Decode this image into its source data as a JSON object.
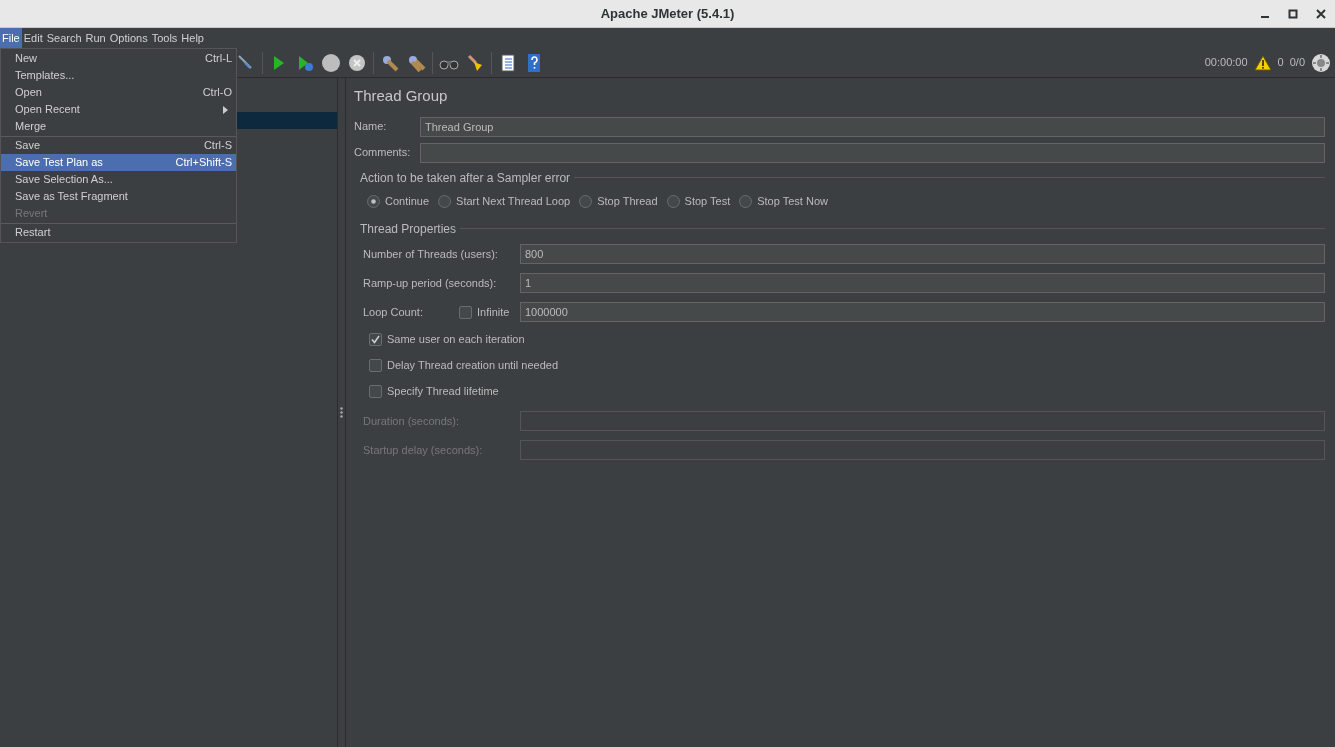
{
  "window": {
    "title": "Apache JMeter (5.4.1)"
  },
  "menu_bar": [
    {
      "label": "File",
      "selected": true
    },
    {
      "label": "Edit",
      "selected": false
    },
    {
      "label": "Search",
      "selected": false
    },
    {
      "label": "Run",
      "selected": false
    },
    {
      "label": "Options",
      "selected": false
    },
    {
      "label": "Tools",
      "selected": false
    },
    {
      "label": "Help",
      "selected": false
    }
  ],
  "file_menu": [
    {
      "label": "New",
      "shortcut": "Ctrl-L",
      "selected": false,
      "disabled": false,
      "submenu": false,
      "separator_after": false
    },
    {
      "label": "Templates...",
      "selected": false,
      "disabled": false,
      "submenu": false,
      "separator_after": false
    },
    {
      "label": "Open",
      "shortcut": "Ctrl-O",
      "selected": false,
      "disabled": false,
      "submenu": false,
      "separator_after": false
    },
    {
      "label": "Open Recent",
      "selected": false,
      "disabled": false,
      "submenu": true,
      "separator_after": false
    },
    {
      "label": "Merge",
      "selected": false,
      "disabled": false,
      "submenu": false,
      "separator_after": true
    },
    {
      "label": "Save",
      "shortcut": "Ctrl-S",
      "selected": false,
      "disabled": false,
      "submenu": false,
      "separator_after": false
    },
    {
      "label": "Save Test Plan as",
      "shortcut": "Ctrl+Shift-S",
      "selected": true,
      "disabled": false,
      "submenu": false,
      "separator_after": false
    },
    {
      "label": "Save Selection As...",
      "selected": false,
      "disabled": false,
      "submenu": false,
      "separator_after": false
    },
    {
      "label": "Save as Test Fragment",
      "selected": false,
      "disabled": false,
      "submenu": false,
      "separator_after": false
    },
    {
      "label": "Revert",
      "selected": false,
      "disabled": true,
      "submenu": false,
      "separator_after": true
    },
    {
      "label": "Restart",
      "selected": false,
      "disabled": false,
      "submenu": false,
      "separator_after": false
    }
  ],
  "toolbar_status": {
    "elapsed": "00:00:00",
    "warnings": "0",
    "threads": "0/0"
  },
  "panel": {
    "title": "Thread Group",
    "name_label": "Name:",
    "name_value": "Thread Group",
    "comments_label": "Comments:",
    "error_action": {
      "legend": "Action to be taken after a Sampler error",
      "options": [
        {
          "label": "Continue",
          "selected": true
        },
        {
          "label": "Start Next Thread Loop",
          "selected": false
        },
        {
          "label": "Stop Thread",
          "selected": false
        },
        {
          "label": "Stop Test",
          "selected": false
        },
        {
          "label": "Stop Test Now",
          "selected": false
        }
      ]
    },
    "thread_properties": {
      "legend": "Thread Properties",
      "threads_label": "Number of Threads (users):",
      "threads_value": "800",
      "rampup_label": "Ramp-up period (seconds):",
      "rampup_value": "1",
      "loop_label": "Loop Count:",
      "infinite": {
        "label": "Infinite",
        "checked": false
      },
      "loop_value": "1000000",
      "options": [
        {
          "label": "Same user on each iteration",
          "checked": true
        },
        {
          "label": "Delay Thread creation until needed",
          "checked": false
        },
        {
          "label": "Specify Thread lifetime",
          "checked": false
        }
      ],
      "duration_label": "Duration (seconds):",
      "duration_disabled": true,
      "startup_label": "Startup delay (seconds):",
      "startup_disabled": true
    }
  }
}
